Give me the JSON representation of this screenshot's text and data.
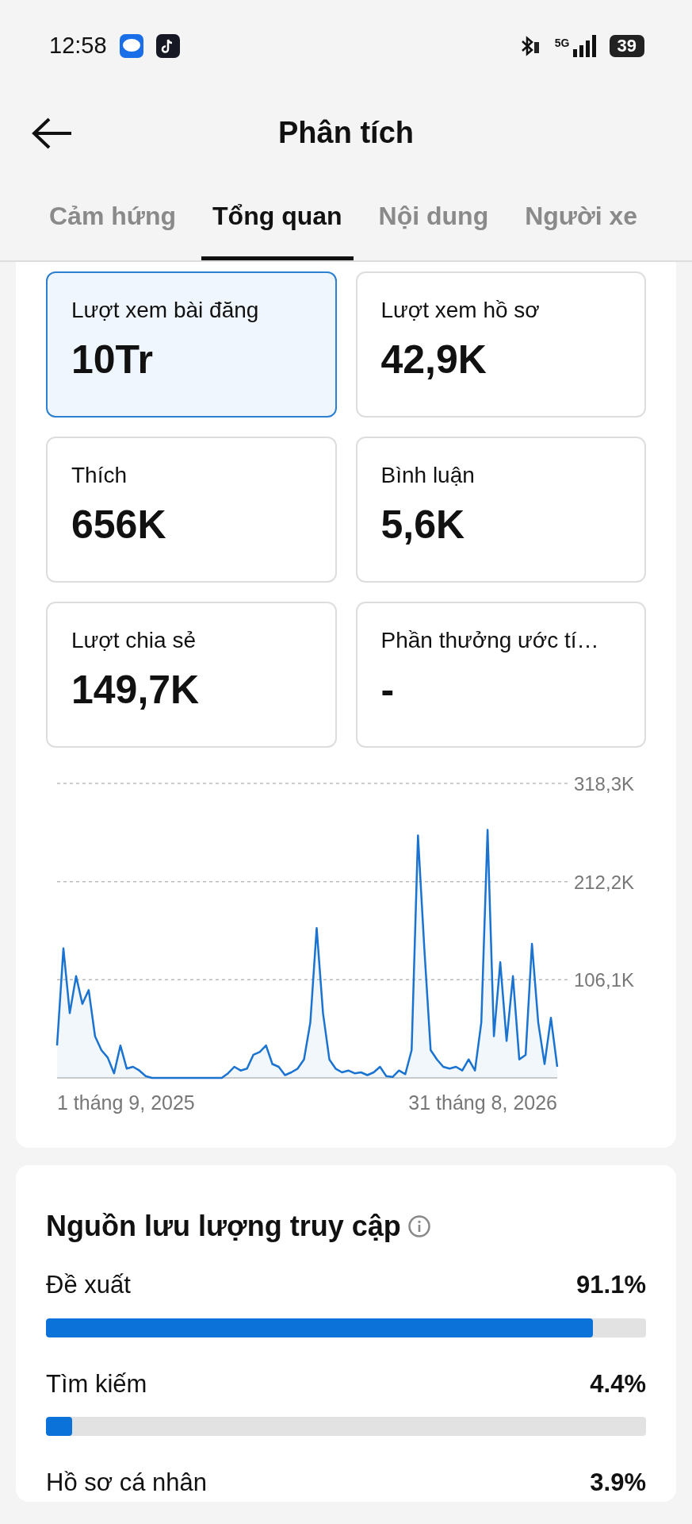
{
  "status_bar": {
    "time": "12:58",
    "network": "5G",
    "battery": "39"
  },
  "header": {
    "title": "Phân tích"
  },
  "tabs": [
    {
      "label": "Cảm hứng",
      "selected": false
    },
    {
      "label": "Tổng quan",
      "selected": true
    },
    {
      "label": "Nội dung",
      "selected": false
    },
    {
      "label": "Người xe",
      "selected": false
    }
  ],
  "stats": [
    {
      "label": "Lượt xem bài đăng",
      "value": "10Tr",
      "selected": true
    },
    {
      "label": "Lượt xem hồ sơ",
      "value": "42,9K",
      "selected": false
    },
    {
      "label": "Thích",
      "value": "656K",
      "selected": false
    },
    {
      "label": "Bình luận",
      "value": "5,6K",
      "selected": false
    },
    {
      "label": "Lượt chia sẻ",
      "value": "149,7K",
      "selected": false
    },
    {
      "label": "Phần thưởng ước tí…",
      "value": "-",
      "selected": false
    }
  ],
  "chart_data": {
    "type": "area",
    "ylim": [
      0,
      318.3
    ],
    "yticks": [
      {
        "value": 106.1,
        "label": "106,1K"
      },
      {
        "value": 212.2,
        "label": "212,2K"
      },
      {
        "value": 318.3,
        "label": "318,3K"
      }
    ],
    "series": [
      {
        "color": "#1a73d0",
        "values": [
          35,
          140,
          70,
          110,
          80,
          95,
          45,
          30,
          22,
          5,
          35,
          10,
          12,
          8,
          2,
          0,
          0,
          0,
          0,
          0,
          0,
          0,
          0,
          0,
          0,
          0,
          0,
          5,
          12,
          8,
          10,
          25,
          28,
          35,
          15,
          12,
          3,
          6,
          10,
          20,
          60,
          162,
          70,
          20,
          10,
          6,
          8,
          5,
          6,
          3,
          6,
          12,
          2,
          1,
          8,
          4,
          30,
          262,
          140,
          30,
          20,
          12,
          10,
          12,
          8,
          20,
          8,
          60,
          268,
          45,
          125,
          40,
          110,
          20,
          25,
          145,
          60,
          15,
          65,
          12
        ]
      }
    ]
  },
  "chart_range": {
    "start": "1 tháng 9, 2025",
    "end": "31 tháng 8, 2026"
  },
  "traffic": {
    "title": "Nguồn lưu lượng truy cập",
    "sources": [
      {
        "label": "Đề xuất",
        "reading": "91.1%",
        "level": 0.911
      },
      {
        "label": "Tìm kiếm",
        "reading": "4.4%",
        "level": 0.044
      },
      {
        "label": "Hồ sơ cá nhân",
        "reading": "3.9%"
      }
    ]
  }
}
